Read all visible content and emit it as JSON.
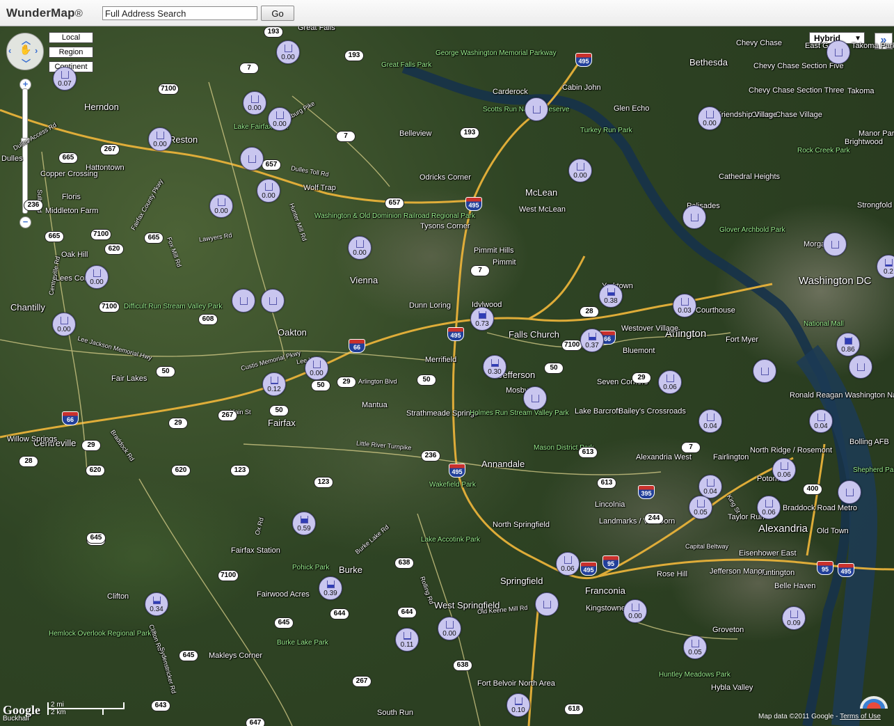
{
  "app": {
    "title": "WunderMap",
    "trademark": "®"
  },
  "search": {
    "value": "Full Address Search",
    "go_label": "Go"
  },
  "controls": {
    "scope_buttons": [
      "Local",
      "Region",
      "Continent"
    ],
    "map_type": "Hybrid",
    "expand_icon": "»",
    "zoom_in": "+",
    "zoom_out": "−"
  },
  "scale": {
    "miles": "2 mi",
    "km": "2 km"
  },
  "attribution": {
    "copyright": "Map data ©2011 Google - ",
    "terms": "Terms of Use"
  },
  "google_logo": {
    "text": "Google",
    "sub": "Buckhall"
  },
  "stations": [
    {
      "v": "0.00",
      "f": 0
    },
    {
      "v": "0.07",
      "f": 0
    },
    {
      "v": "0.00",
      "f": 0
    },
    {
      "v": "0.00",
      "f": 0
    },
    {
      "v": "0.00",
      "f": 0
    },
    {
      "v": "",
      "f": 0
    },
    {
      "v": "0.00",
      "f": 0
    },
    {
      "v": "0.00",
      "f": 0
    },
    {
      "v": "0.00",
      "f": 0
    },
    {
      "v": "0.00",
      "f": 0
    },
    {
      "v": "",
      "f": 0
    },
    {
      "v": "0.00",
      "f": 0
    },
    {
      "v": "0.00",
      "f": 0
    },
    {
      "v": "",
      "f": 0
    },
    {
      "v": "",
      "f": 0
    },
    {
      "v": "0.38",
      "f": 0.4
    },
    {
      "v": "0.03",
      "f": 0
    },
    {
      "v": "",
      "f": 0
    },
    {
      "v": "0.73",
      "f": 0.7
    },
    {
      "v": "0.37",
      "f": 0.4
    },
    {
      "v": "0.00",
      "f": 0
    },
    {
      "v": "0.12",
      "f": 0.1
    },
    {
      "v": "0.30",
      "f": 0.3
    },
    {
      "v": "",
      "f": 0
    },
    {
      "v": "0.06",
      "f": 0
    },
    {
      "v": "",
      "f": 0
    },
    {
      "v": "0.86",
      "f": 0.85
    },
    {
      "v": "",
      "f": 0
    },
    {
      "v": "0.04",
      "f": 0
    },
    {
      "v": "0.04",
      "f": 0
    },
    {
      "v": "0.06",
      "f": 0
    },
    {
      "v": "0.04",
      "f": 0
    },
    {
      "v": "0.05",
      "f": 0
    },
    {
      "v": "0.06",
      "f": 0
    },
    {
      "v": "",
      "f": 0
    },
    {
      "v": "0.59",
      "f": 0.6
    },
    {
      "v": "0.06",
      "f": 0
    },
    {
      "v": "0.39",
      "f": 0.4
    },
    {
      "v": "0.34",
      "f": 0.35
    },
    {
      "v": "",
      "f": 0
    },
    {
      "v": "0.00",
      "f": 0
    },
    {
      "v": "0.11",
      "f": 0.1
    },
    {
      "v": "0.00",
      "f": 0
    },
    {
      "v": "0.09",
      "f": 0
    },
    {
      "v": "0.05",
      "f": 0
    },
    {
      "v": "0.10",
      "f": 0.1
    },
    {
      "v": "",
      "f": 0
    },
    {
      "v": "0.00",
      "f": 0
    },
    {
      "v": "",
      "f": 0
    },
    {
      "v": "0.2",
      "f": 0.2
    }
  ],
  "place_labels": [
    "Great Falls",
    "Herndon",
    "Reston",
    "Dulles",
    "Copper Crossing",
    "Floris",
    "Middleton Farm",
    "Hattontown",
    "Oak Hill",
    "Lees Corner",
    "Chantilly",
    "Fair Lakes",
    "Centreville",
    "Willow Springs",
    "Fairfax",
    "Oakton",
    "Vienna",
    "Tysons Corner",
    "McLean",
    "West McLean",
    "Pimmit Hills",
    "Pimmit",
    "Dunn Loring",
    "Idylwood",
    "Merrifield",
    "Falls Church",
    "Jefferson",
    "Mosby",
    "Mantua",
    "Strathmeade Springs",
    "Annandale",
    "Seven Corners",
    "Lake Barcroft",
    "Bailey's Crossroads",
    "Arlington",
    "Fort Myer",
    "Washington DC",
    "Bethesda",
    "Chevy Chase",
    "Cabin John",
    "Glen Echo",
    "Carderock",
    "Cathedral Heights",
    "Palisades",
    "Springfield",
    "North Springfield",
    "Burke",
    "Fairfax Station",
    "Clifton",
    "West Springfield",
    "Franconia",
    "Kingstowne",
    "Lincolnia",
    "Landmarks / Van Dorn",
    "Alexandria",
    "Old Town",
    "Rose Hill",
    "Huntington",
    "Groveton",
    "Hybla Valley",
    "Fort Belvoir North Area",
    "Fairwood Acres",
    "Makleys Corner",
    "Belle Haven",
    "Ronald Reagan Washington National Airport",
    "Bolling AFB",
    "Potomac",
    "Braddock Road Metro",
    "Taylor Run",
    "Jefferson Manor",
    "Eisenhower East",
    "Alexandria West",
    "Fairlington",
    "North Ridge / Rosemont",
    "Westover Village",
    "Bluemont",
    "Yorktown",
    "Courthouse",
    "Takoma",
    "Brightwood",
    "Manor Park",
    "Strongfold",
    "Wolf Trap",
    "Odricks Corner",
    "Belleview",
    "Chevy Chase Village",
    "Chevy Chase Section Five",
    "Chevy Chase Section Three",
    "Friendship Village",
    "Takoma Park",
    "South Run",
    "Morgan",
    "East Gate"
  ],
  "green_labels": [
    "Great Falls Park",
    "George Washington Memorial Parkway",
    "Scotts Run Nature Preserve",
    "Turkey Run Park",
    "Lake Fairfax Park",
    "Washington & Old Dominion Railroad Regional Park",
    "Difficult Run Stream Valley Park",
    "Rock Creek Park",
    "Glover Archbold Park",
    "National Mall",
    "Holmes Run Stream Valley Park",
    "Mason District Park",
    "Lake Accotink Park",
    "Wakefield Park",
    "Pohick Park",
    "Burke Lake Park",
    "Hemlock Overlook Regional Park",
    "Huntley Meadows Park",
    "Shepherd Parkway"
  ],
  "road_labels": [
    "Dulles Access Rd",
    "Dulles Toll Rd",
    "Leesburg Pike",
    "Lawyers Rd",
    "Hunter Mill Rd",
    "Custis Memorial Pkwy",
    "Lee Jackson Memorial Hwy",
    "Lee Hwy",
    "Arlington Blvd",
    "Little River Turnpike",
    "Main St",
    "Capital Beltway",
    "Old Keene Mill Rd",
    "Fairfax County Pkwy",
    "Ox Rd",
    "Clifton Rd",
    "Sully Rd",
    "Centreville Rd",
    "Fox Mill Rd",
    "Braddock Rd",
    "Rolling Rd",
    "Burke Lake Rd",
    "King St",
    "Sydenstricker Rd"
  ],
  "shields": [
    "193",
    "193",
    "193",
    "7",
    "7",
    "7",
    "7100",
    "7100",
    "7100",
    "7100",
    "267",
    "267",
    "267",
    "657",
    "657",
    "665",
    "665",
    "665",
    "608",
    "620",
    "620",
    "620",
    "123",
    "123",
    "50",
    "50",
    "50",
    "50",
    "50",
    "29",
    "29",
    "29",
    "29",
    "28",
    "28",
    "236",
    "236",
    "244",
    "613",
    "613",
    "7",
    "400",
    "638",
    "638",
    "644",
    "644",
    "645",
    "645",
    "645",
    "643",
    "647",
    "618",
    "645",
    "7100"
  ],
  "interstates": [
    "495",
    "495",
    "495",
    "66",
    "66",
    "66",
    "95",
    "95",
    "495",
    "395",
    "495",
    "495"
  ]
}
